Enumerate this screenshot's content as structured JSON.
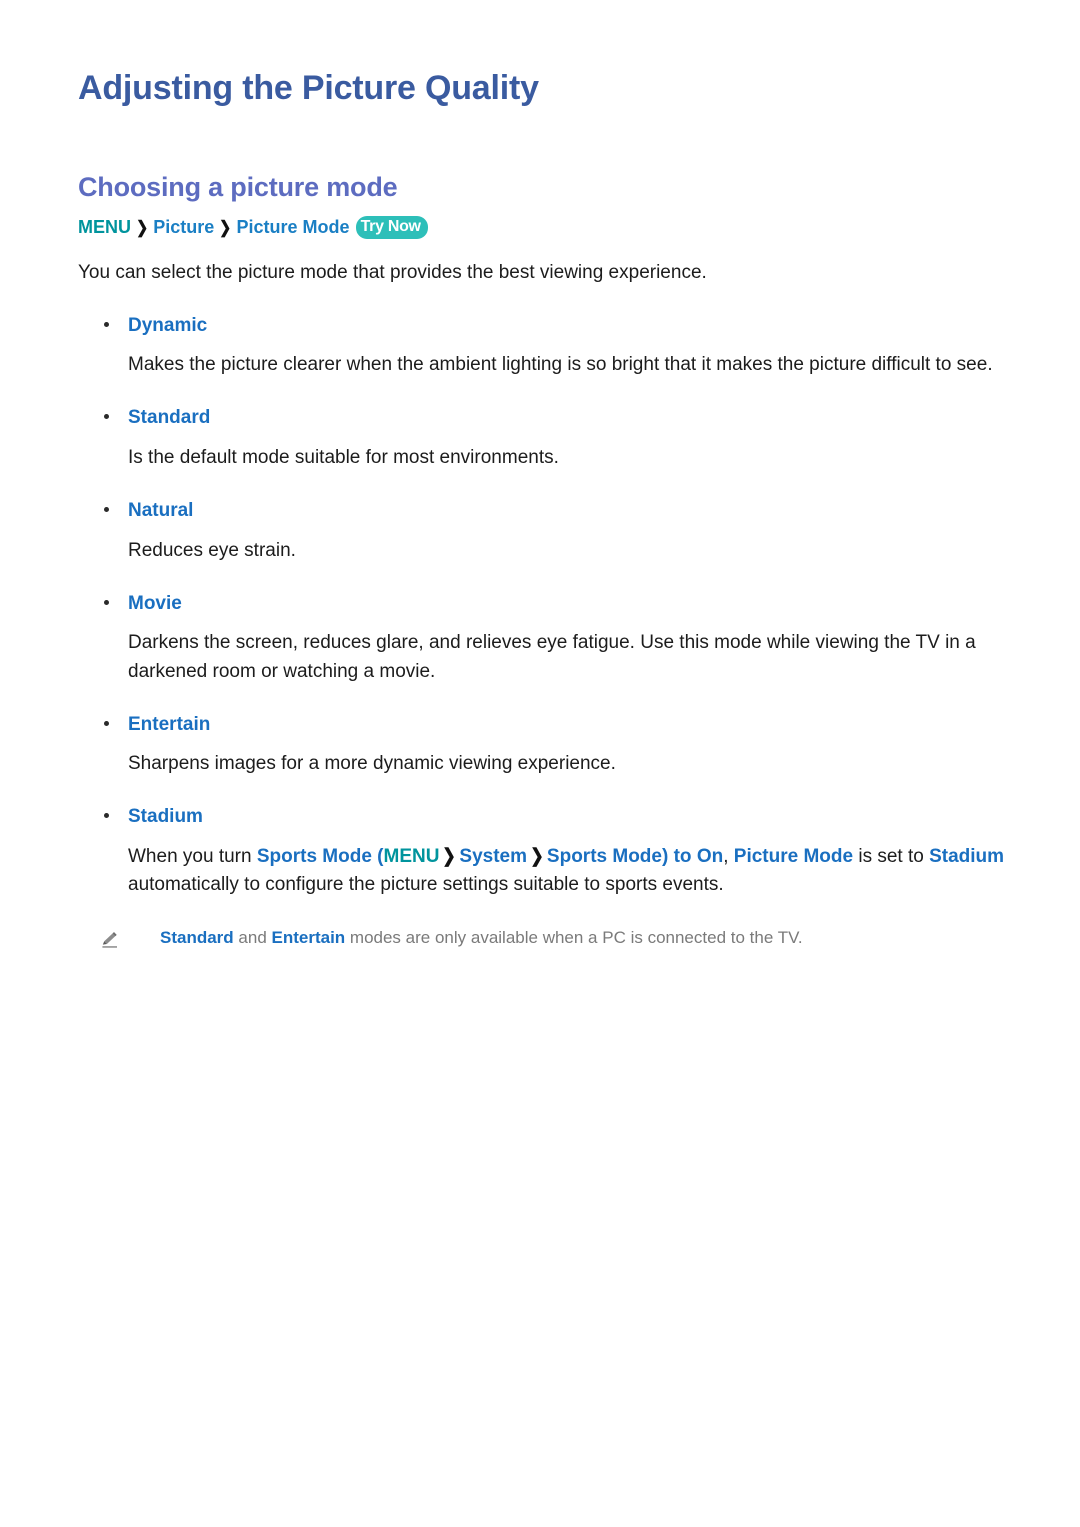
{
  "document": {
    "title": "Adjusting the Picture Quality",
    "section_title": "Choosing a picture mode"
  },
  "breadcrumb": {
    "menu": "MENU",
    "sep1": "❯",
    "picture": "Picture",
    "sep2": "❯",
    "picture_mode": "Picture Mode",
    "try_now": "Try Now"
  },
  "intro": "You can select the picture mode that provides the best viewing experience.",
  "modes": [
    {
      "name": "Dynamic",
      "description": "Makes the picture clearer when the ambient lighting is so bright that it makes the picture difficult to see."
    },
    {
      "name": "Standard",
      "description": "Is the default mode suitable for most environments."
    },
    {
      "name": "Natural",
      "description": "Reduces eye strain."
    },
    {
      "name": "Movie",
      "description": "Darkens the screen, reduces glare, and relieves eye fatigue. Use this mode while viewing the TV in a darkened room or watching a movie."
    },
    {
      "name": "Entertain",
      "description": "Sharpens images for a more dynamic viewing experience."
    }
  ],
  "stadium": {
    "name": "Stadium",
    "t1": "When you turn ",
    "sports_mode_1": "Sports Mode",
    "t2": " (",
    "menu": "MENU",
    "sep1": "❯",
    "system": "System",
    "sep2": "❯",
    "sports_mode_2": "Sports Mode",
    "t3": ") to ",
    "on": "On",
    "t4": ", ",
    "picture_mode": "Picture Mode",
    "t5": " is set to ",
    "stadium_word": "Stadium",
    "t6": " automatically to configure the picture settings suitable to sports events."
  },
  "note": {
    "icon": "pencil-icon",
    "standard": "Standard",
    "mid": " and ",
    "entertain": "Entertain",
    "tail": " modes are only available when a PC is connected to the TV."
  },
  "colors": {
    "title": "#3a5ba0",
    "section_title": "#5d6cc0",
    "link_blue": "#1a6fc0",
    "teal": "#00949d",
    "badge_bg": "#2dbfb9",
    "body_text": "#1c1c1c",
    "note_text": "#7a7a7a"
  }
}
